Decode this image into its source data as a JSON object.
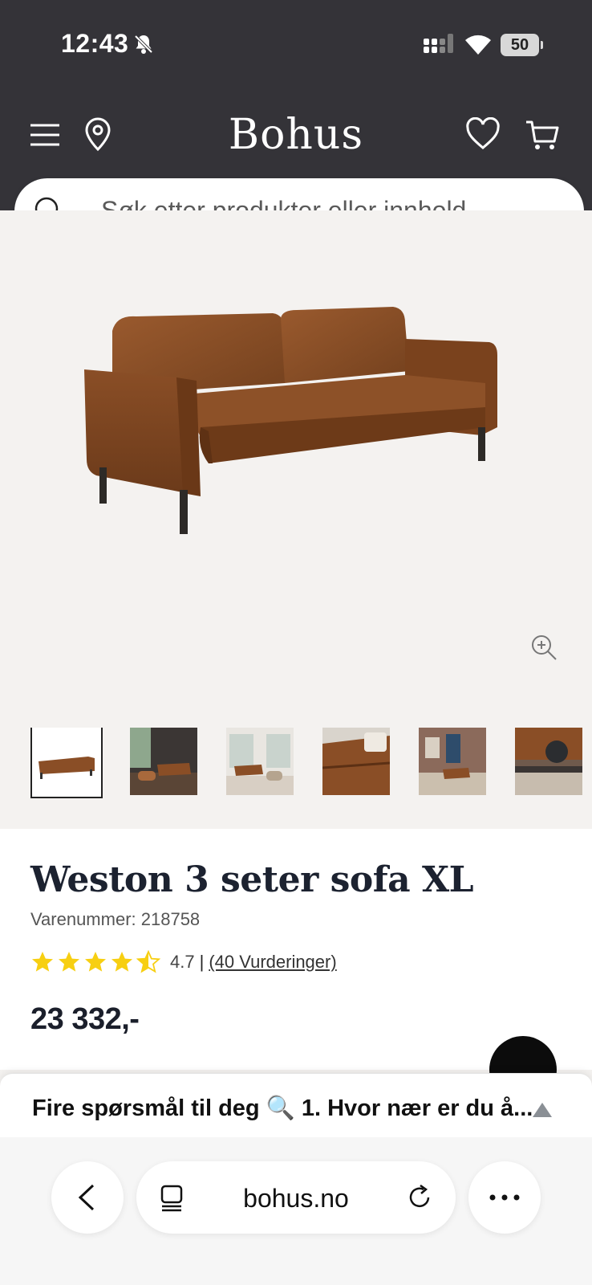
{
  "status_bar": {
    "time": "12:43",
    "battery": "50"
  },
  "header": {
    "logo": "Bohus"
  },
  "search": {
    "placeholder": "Søk etter produkter eller innhold ..."
  },
  "gallery": {
    "thumbnail_count": 6,
    "active_index": 0
  },
  "product": {
    "title": "Weston 3 seter sofa XL",
    "sku_label": "Varenummer: 218758",
    "rating_value": "4.7",
    "rating_separator": "|",
    "rating_count_label": "(40 Vurderinger)",
    "rating_stars": 4.7,
    "price": "23 332,-"
  },
  "survey": {
    "text": "Fire spørsmål til deg 🔍 1. Hvor nær er du å..."
  },
  "browser": {
    "url": "bohus.no"
  },
  "colors": {
    "header_bg": "#343338",
    "star": "#f7cf12",
    "page_bg": "#f4f2f0"
  }
}
